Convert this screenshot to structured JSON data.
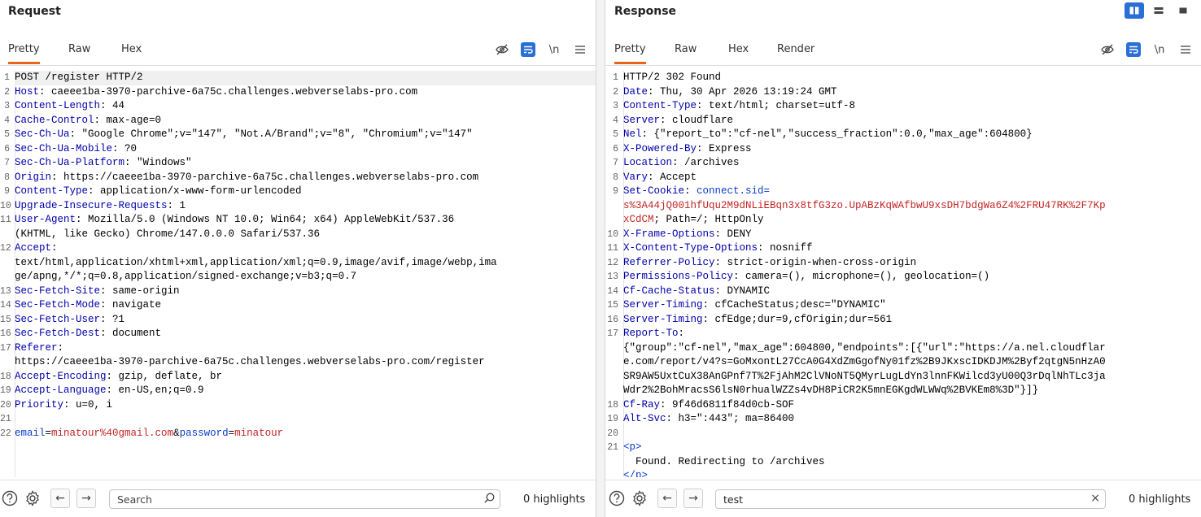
{
  "request": {
    "title": "Request",
    "tabs": [
      "Pretty",
      "Raw",
      "Hex"
    ],
    "active_tab": "Pretty",
    "newline_label": "\\n",
    "lines": [
      {
        "n": "1",
        "h": "",
        "v": "POST /register HTTP/2",
        "hl": true
      },
      {
        "n": "2",
        "h": "Host",
        "v": ": caeee1ba-3970-parchive-6a75c.challenges.webverselabs-pro.com"
      },
      {
        "n": "3",
        "h": "Content-Length",
        "v": ": 44"
      },
      {
        "n": "4",
        "h": "Cache-Control",
        "v": ": max-age=0"
      },
      {
        "n": "5",
        "h": "Sec-Ch-Ua",
        "v": ": \"Google Chrome\";v=\"147\", \"Not.A/Brand\";v=\"8\", \"Chromium\";v=\"147\""
      },
      {
        "n": "6",
        "h": "Sec-Ch-Ua-Mobile",
        "v": ": ?0"
      },
      {
        "n": "7",
        "h": "Sec-Ch-Ua-Platform",
        "v": ": \"Windows\""
      },
      {
        "n": "8",
        "h": "Origin",
        "v": ": https://caeee1ba-3970-parchive-6a75c.challenges.webverselabs-pro.com"
      },
      {
        "n": "9",
        "h": "Content-Type",
        "v": ": application/x-www-form-urlencoded"
      },
      {
        "n": "10",
        "h": "Upgrade-Insecure-Requests",
        "v": ": 1"
      },
      {
        "n": "11",
        "h": "User-Agent",
        "v": ": Mozilla/5.0 (Windows NT 10.0; Win64; x64) AppleWebKit/537.36"
      },
      {
        "n": "",
        "h": "",
        "v": "(KHTML, like Gecko) Chrome/147.0.0.0 Safari/537.36"
      },
      {
        "n": "12",
        "h": "Accept",
        "v": ":"
      },
      {
        "n": "",
        "h": "",
        "v": "text/html,application/xhtml+xml,application/xml;q=0.9,image/avif,image/webp,ima"
      },
      {
        "n": "",
        "h": "",
        "v": "ge/apng,*/*;q=0.8,application/signed-exchange;v=b3;q=0.7"
      },
      {
        "n": "13",
        "h": "Sec-Fetch-Site",
        "v": ": same-origin"
      },
      {
        "n": "14",
        "h": "Sec-Fetch-Mode",
        "v": ": navigate"
      },
      {
        "n": "15",
        "h": "Sec-Fetch-User",
        "v": ": ?1"
      },
      {
        "n": "16",
        "h": "Sec-Fetch-Dest",
        "v": ": document"
      },
      {
        "n": "17",
        "h": "Referer",
        "v": ":"
      },
      {
        "n": "",
        "h": "",
        "v": "https://caeee1ba-3970-parchive-6a75c.challenges.webverselabs-pro.com/register"
      },
      {
        "n": "18",
        "h": "Accept-Encoding",
        "v": ": gzip, deflate, br"
      },
      {
        "n": "19",
        "h": "Accept-Language",
        "v": ": en-US,en;q=0.9"
      },
      {
        "n": "20",
        "h": "Priority",
        "v": ": u=0, i"
      },
      {
        "n": "21",
        "h": "",
        "v": ""
      },
      {
        "n": "22",
        "body": [
          {
            "t": "email",
            "c": "blu"
          },
          {
            "t": "=",
            "c": ""
          },
          {
            "t": "minatour%40gmail.com",
            "c": "red"
          },
          {
            "t": "&",
            "c": ""
          },
          {
            "t": "password",
            "c": "blu"
          },
          {
            "t": "=",
            "c": ""
          },
          {
            "t": "minatour",
            "c": "red"
          }
        ]
      }
    ],
    "search": {
      "placeholder": "Search",
      "value": ""
    },
    "highlights": "0 highlights"
  },
  "response": {
    "title": "Response",
    "tabs": [
      "Pretty",
      "Raw",
      "Hex",
      "Render"
    ],
    "active_tab": "Pretty",
    "newline_label": "\\n",
    "lines": [
      {
        "n": "1",
        "h": "",
        "v": "HTTP/2 302 Found"
      },
      {
        "n": "2",
        "h": "Date",
        "v": ": Thu, 30 Apr 2026 13:19:24 GMT"
      },
      {
        "n": "3",
        "h": "Content-Type",
        "v": ": text/html; charset=utf-8"
      },
      {
        "n": "4",
        "h": "Server",
        "v": ": cloudflare"
      },
      {
        "n": "5",
        "h": "Nel",
        "v": ": {\"report_to\":\"cf-nel\",\"success_fraction\":0.0,\"max_age\":604800}"
      },
      {
        "n": "6",
        "h": "X-Powered-By",
        "v": ": Express"
      },
      {
        "n": "7",
        "h": "Location",
        "v": ": /archives"
      },
      {
        "n": "8",
        "h": "Vary",
        "v": ": Accept"
      },
      {
        "n": "9",
        "h": "Set-Cookie",
        "v": ": ",
        "cookie_name": "connect.sid="
      },
      {
        "n": "",
        "h": "",
        "v": "",
        "red": "s%3A44jQ001hfUqu2M9dNLiEBqn3x8tfG3zo.UpABzKqWAfbwU9xsDH7bdgWa6Z4%2FRU47RK%2F7Kp"
      },
      {
        "n": "",
        "h": "",
        "v": "; Path=/; HttpOnly",
        "red": "xCdCM"
      },
      {
        "n": "10",
        "h": "X-Frame-Options",
        "v": ": DENY"
      },
      {
        "n": "11",
        "h": "X-Content-Type-Options",
        "v": ": nosniff"
      },
      {
        "n": "12",
        "h": "Referrer-Policy",
        "v": ": strict-origin-when-cross-origin"
      },
      {
        "n": "13",
        "h": "Permissions-Policy",
        "v": ": camera=(), microphone=(), geolocation=()"
      },
      {
        "n": "14",
        "h": "Cf-Cache-Status",
        "v": ": DYNAMIC"
      },
      {
        "n": "15",
        "h": "Server-Timing",
        "v": ": cfCacheStatus;desc=\"DYNAMIC\""
      },
      {
        "n": "16",
        "h": "Server-Timing",
        "v": ": cfEdge;dur=9,cfOrigin;dur=561"
      },
      {
        "n": "17",
        "h": "Report-To",
        "v": ":"
      },
      {
        "n": "",
        "h": "",
        "v": "{\"group\":\"cf-nel\",\"max_age\":604800,\"endpoints\":[{\"url\":\"https://a.nel.cloudflar"
      },
      {
        "n": "",
        "h": "",
        "v": "e.com/report/v4?s=GoMxontL27CcA0G4XdZmGgofNy01fz%2B9JKxscIDKDJM%2Byf2qtgN5nHzA0"
      },
      {
        "n": "",
        "h": "",
        "v": "SR9AW5UxtCuX38AnGPnf7T%2FjAhM2ClVNoNT5QMyrLugLdYn3lnnFKWilcd3yU00Q3rDqlNhTLc3ja"
      },
      {
        "n": "",
        "h": "",
        "v": "Wdr2%2BohMracsS6lsN0rhualWZZs4vDH8PiCR2K5mnEGKgdWLWWq%2BVKEm8%3D\"}]}"
      },
      {
        "n": "18",
        "h": "Cf-Ray",
        "v": ": 9f46d6811f84d0cb-SOF"
      },
      {
        "n": "19",
        "h": "Alt-Svc",
        "v": ": h3=\":443\"; ma=86400"
      },
      {
        "n": "20",
        "h": "",
        "v": ""
      },
      {
        "n": "21",
        "tag": "<p>"
      },
      {
        "n": "",
        "h": "",
        "v": "  Found. Redirecting to /archives"
      },
      {
        "n": "",
        "tag": "</p>"
      }
    ],
    "search": {
      "placeholder": "Search",
      "value": "test"
    },
    "highlights": "0 highlights",
    "clear_label": "×"
  },
  "colors": {
    "accent_orange": "#e8641b",
    "accent_blue": "#2a6fd6",
    "header_name": "#0000aa",
    "param_value": "#c42424"
  }
}
